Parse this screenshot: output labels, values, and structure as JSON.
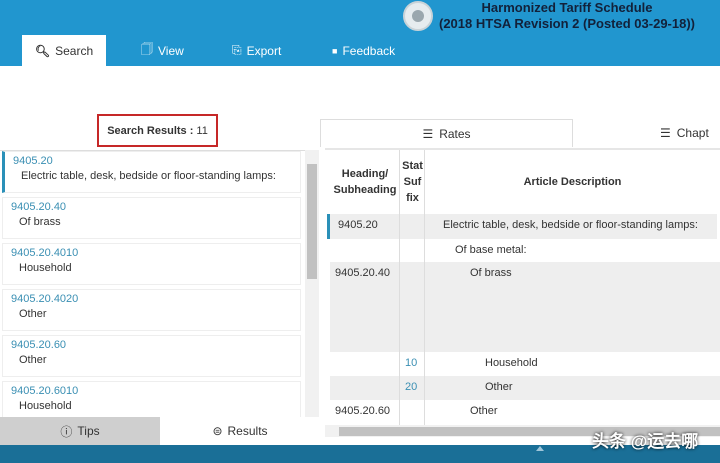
{
  "header": {
    "title_line1": "Harmonized Tariff Schedule",
    "title_line2": "(2018 HTSA Revision 2 (Posted 03-29-18))",
    "color": "#2196cf"
  },
  "nav_tabs": [
    {
      "label": "Search",
      "icon": "search-icon",
      "active": true
    },
    {
      "label": "View",
      "icon": "document-icon"
    },
    {
      "label": "Export",
      "icon": "export-icon"
    },
    {
      "label": "Feedback",
      "icon": "chat-icon"
    }
  ],
  "search_results": {
    "label": "Search Results :",
    "count": "11"
  },
  "results": [
    {
      "code": "9405.20",
      "desc": "Electric table, desk, bedside or floor-standing lamps:",
      "selected": true
    },
    {
      "code": "9405.20.40",
      "desc": "Of brass"
    },
    {
      "code": "9405.20.4010",
      "desc": "Household"
    },
    {
      "code": "9405.20.4020",
      "desc": "Other"
    },
    {
      "code": "9405.20.60",
      "desc": "Other"
    },
    {
      "code": "9405.20.6010",
      "desc": "Household"
    }
  ],
  "bottom_tabs": {
    "tips": "Tips",
    "results": "Results"
  },
  "right_tabs": {
    "rates": "Rates",
    "chapter": "Chapt"
  },
  "table": {
    "headers": {
      "heading": "Heading/ Subheading",
      "stat": "Stat Suf fix",
      "desc": "Article Description"
    },
    "rows": [
      {
        "heading": "9405.20",
        "stat": "",
        "desc": "Electric table, desk, bedside or floor-standing lamps:"
      },
      {
        "heading": "",
        "stat": "",
        "desc": "Of base metal:"
      },
      {
        "heading": "9405.20.40",
        "stat": "",
        "desc": "Of brass"
      },
      {
        "heading": "",
        "stat": "10",
        "desc": "Household"
      },
      {
        "heading": "",
        "stat": "20",
        "desc": "Other"
      },
      {
        "heading": "9405.20.60",
        "stat": "",
        "desc": "Other"
      }
    ]
  },
  "watermark": "头条 @运去哪"
}
